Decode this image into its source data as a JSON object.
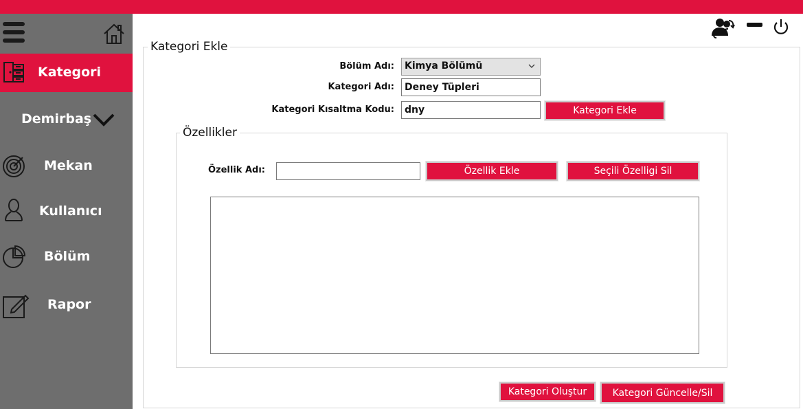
{
  "colors": {
    "accent": "#e0123e",
    "sidebar": "#6e6e6e"
  },
  "sidebar": {
    "items": [
      {
        "label": "Kategori",
        "icon": "cabinet-icon",
        "active": true
      },
      {
        "label": "Demirbaş",
        "icon": "chevron-down-icon",
        "active": false
      },
      {
        "label": "Mekan",
        "icon": "radar-icon",
        "active": false
      },
      {
        "label": "Kullanıcı",
        "icon": "user-icon",
        "active": false
      },
      {
        "label": "Bölüm",
        "icon": "pie-chart-icon",
        "active": false
      },
      {
        "label": "Rapor",
        "icon": "edit-icon",
        "active": false
      }
    ]
  },
  "header": {
    "icons": [
      "switch-user-icon",
      "minimize-icon",
      "power-icon"
    ]
  },
  "form": {
    "legend": "Kategori Ekle",
    "bolum_label": "Bölüm Adı:",
    "bolum_value": "Kimya Bölümü",
    "kategori_label": "Kategori Adı:",
    "kategori_value": "Deney Tüpleri",
    "kisaltma_label": "Kategori Kısaltma Kodu:",
    "kisaltma_value": "dny",
    "kategori_ekle_button": "Kategori Ekle"
  },
  "ozellikler": {
    "legend": "Özellikler",
    "ozellik_label": "Özellik Adı:",
    "ozellik_value": "",
    "ozellik_ekle_button": "Özellik Ekle",
    "sil_button": "Seçili Özelligi Sil",
    "items": []
  },
  "footer": {
    "olustur_button": "Kategori Oluştur",
    "guncelle_button": "Kategori Güncelle/Sil"
  }
}
